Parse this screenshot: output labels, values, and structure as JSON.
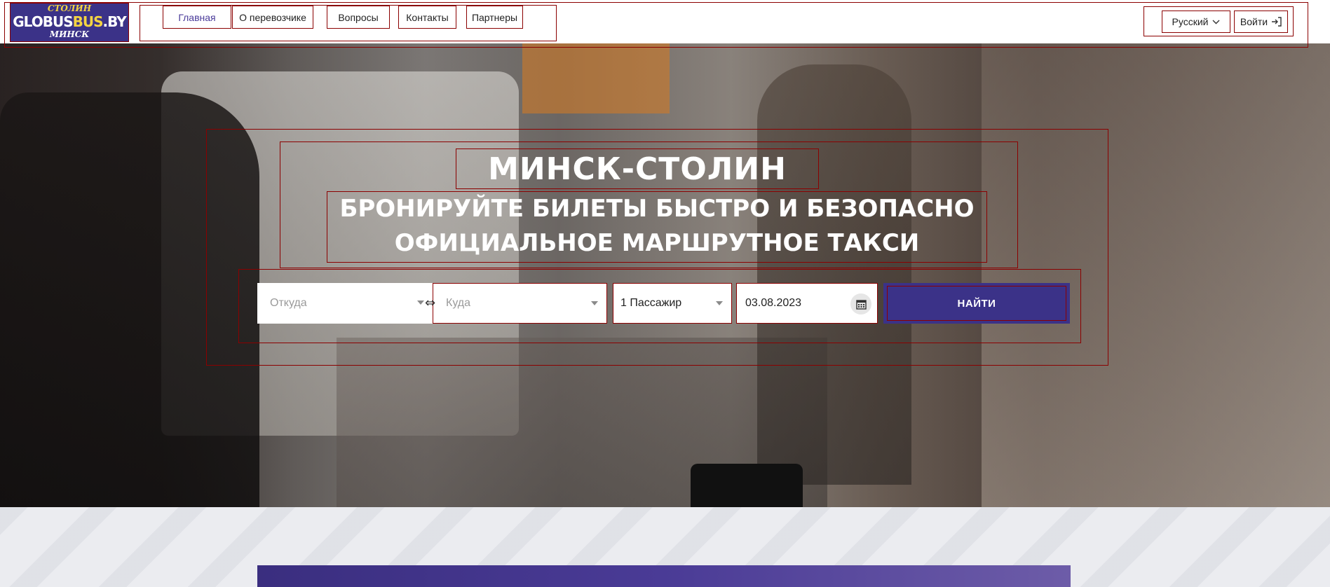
{
  "header": {
    "logo": {
      "top": "СТОЛИН",
      "main_left": "GLOBUS",
      "main_accent": "BUS",
      "main_right": ".BY",
      "bottom": "МИНСК"
    },
    "nav": [
      {
        "label": "Главная",
        "active": true
      },
      {
        "label": "О перевозчике",
        "active": false
      },
      {
        "label": "Вопросы",
        "active": false
      },
      {
        "label": "Контакты",
        "active": false
      },
      {
        "label": "Партнеры",
        "active": false
      }
    ],
    "language": "Русский",
    "login": "Войти"
  },
  "hero": {
    "title": "МИНСК-СТОЛИН",
    "subtitle_line1": "БРОНИРУЙТЕ БИЛЕТЫ БЫСТРО И БЕЗОПАСНО",
    "subtitle_line2": "ОФИЦИАЛЬНОЕ МАРШРУТНОЕ ТАКСИ"
  },
  "search": {
    "from_placeholder": "Откуда",
    "to_placeholder": "Куда",
    "passengers": "1 Пассажир",
    "date": "03.08.2023",
    "submit": "НАЙТИ"
  },
  "colors": {
    "brand": "#3b3288",
    "accent": "#f4d442",
    "annotation": "#8b0000"
  },
  "icons": [
    "swap-icon",
    "chevron-down-icon",
    "login-arrow-icon",
    "calendar-icon"
  ]
}
